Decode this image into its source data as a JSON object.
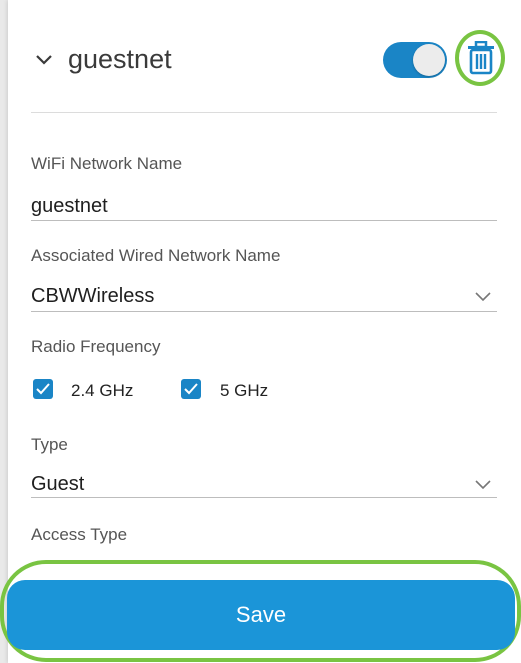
{
  "network": {
    "name": "guestnet",
    "enabled": true,
    "expand_icon": "chevron-down-icon",
    "delete_icon": "trash-icon"
  },
  "form": {
    "ssid_label": "WiFi Network Name",
    "ssid_value": "guestnet",
    "wired_label": "Associated Wired Network Name",
    "wired_value": "CBWWireless",
    "radio_label": "Radio Frequency",
    "radio_options": [
      {
        "label": "2.4 GHz",
        "checked": true
      },
      {
        "label": "5 GHz",
        "checked": true
      }
    ],
    "type_label": "Type",
    "type_value": "Guest",
    "access_label": "Access Type"
  },
  "actions": {
    "save_label": "Save"
  },
  "colors": {
    "accent": "#1a85c6",
    "save_button": "#1b95d8",
    "highlight_ring": "#79c442"
  }
}
